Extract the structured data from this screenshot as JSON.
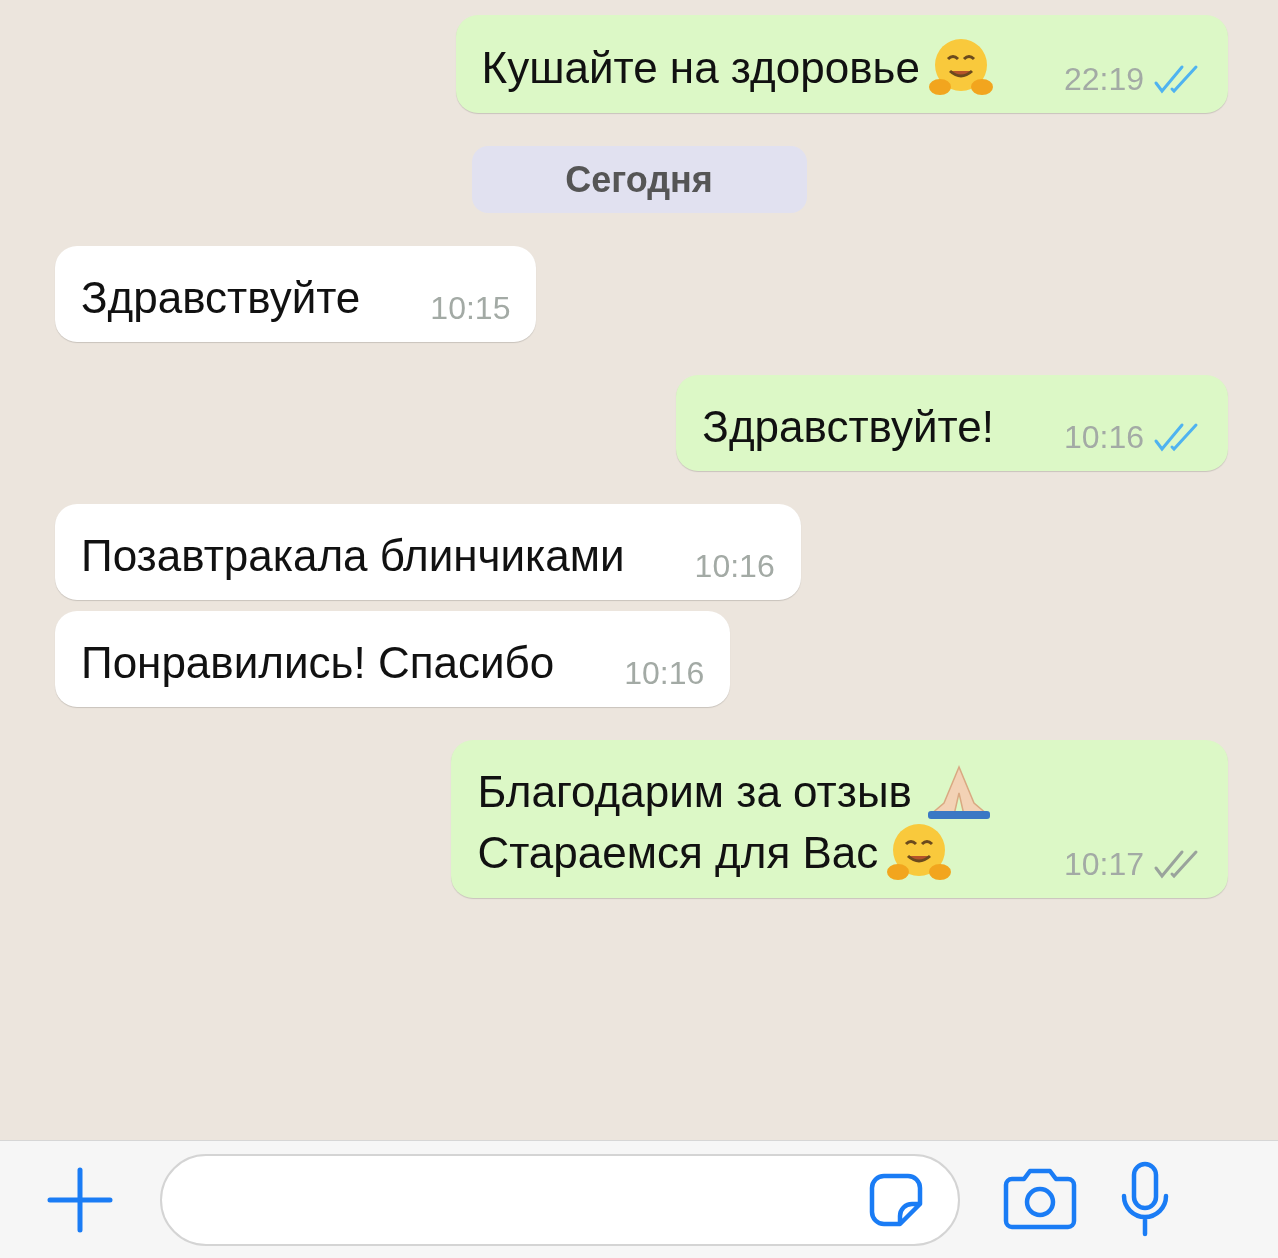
{
  "messages": [
    {
      "kind": "message",
      "outgoing": true,
      "lines": [
        {
          "kind": "hug",
          "text": "Кушайте на здоровье"
        }
      ],
      "time": "22:19",
      "read": true
    },
    {
      "kind": "date",
      "text": "Сегодня"
    },
    {
      "kind": "message",
      "outgoing": false,
      "lines": [
        {
          "kind": "plain",
          "text": "Здравствуйте"
        }
      ],
      "time": "10:15"
    },
    {
      "kind": "message",
      "outgoing": true,
      "lines": [
        {
          "kind": "plain",
          "text": "Здравствуйте!"
        }
      ],
      "time": "10:16",
      "read": true
    },
    {
      "kind": "message",
      "outgoing": false,
      "lines": [
        {
          "kind": "plain",
          "text": "Позавтракала блинчиками"
        }
      ],
      "time": "10:16"
    },
    {
      "kind": "message",
      "outgoing": false,
      "lines": [
        {
          "kind": "plain",
          "text": "Понравились! Спасибо"
        }
      ],
      "time": "10:16"
    },
    {
      "kind": "message",
      "outgoing": true,
      "lines": [
        {
          "kind": "pray",
          "text": "Благодарим за отзыв"
        },
        {
          "kind": "hug",
          "text": "Стараемся для Вас"
        }
      ],
      "time": "10:17",
      "read": false
    }
  ]
}
